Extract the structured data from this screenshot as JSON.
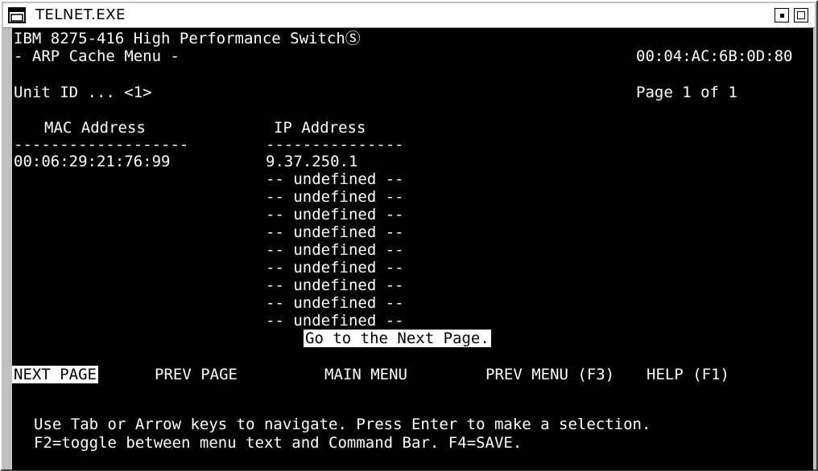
{
  "window": {
    "title": "TELNET.EXE"
  },
  "terminal": {
    "header_line": "IBM 8275-416 High Performance SwitchⓈ",
    "menu_title": "- ARP Cache Menu -",
    "mac_top": "00:04:AC:6B:0D:80",
    "unit_id": "Unit ID ... <1>",
    "page_indicator": "Page 1 of 1",
    "columns": {
      "mac_header": "MAC Address",
      "ip_header": "IP Address",
      "mac_underline": "-------------------",
      "ip_underline": "---------------"
    },
    "rows": [
      {
        "mac": "00:06:29:21:76:99",
        "ip": "9.37.250.1"
      },
      {
        "mac": "",
        "ip": "-- undefined --"
      },
      {
        "mac": "",
        "ip": "-- undefined --"
      },
      {
        "mac": "",
        "ip": "-- undefined --"
      },
      {
        "mac": "",
        "ip": "-- undefined --"
      },
      {
        "mac": "",
        "ip": "-- undefined --"
      },
      {
        "mac": "",
        "ip": "-- undefined --"
      },
      {
        "mac": "",
        "ip": "-- undefined --"
      },
      {
        "mac": "",
        "ip": "-- undefined --"
      },
      {
        "mac": "",
        "ip": "-- undefined --"
      }
    ],
    "status_message": "Go to the Next Page.",
    "command_bar": {
      "next_page": "NEXT PAGE",
      "prev_page": "PREV PAGE",
      "main_menu": "MAIN MENU",
      "prev_menu": "PREV MENU (F3)",
      "help": "HELP (F1)"
    },
    "help_line1": "Use Tab or Arrow keys to navigate. Press Enter to make a selection.",
    "help_line2": "F2=toggle between menu text and Command Bar. F4=SAVE."
  }
}
